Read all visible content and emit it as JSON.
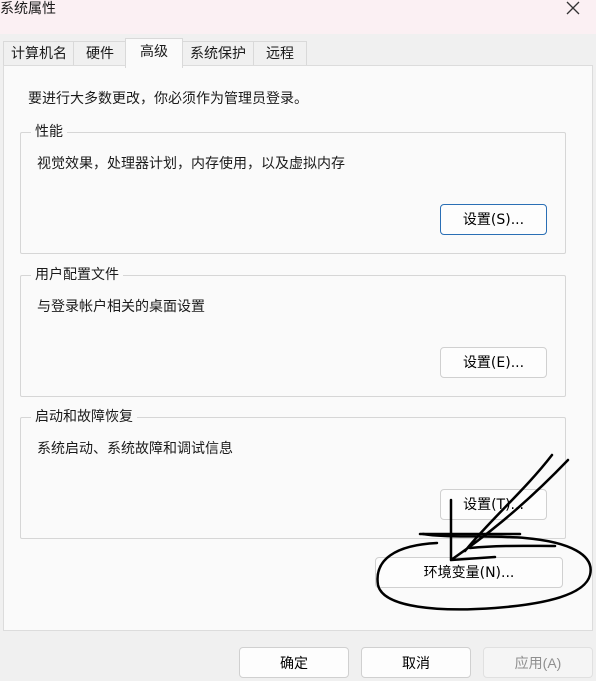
{
  "window": {
    "title": "系统属性"
  },
  "tabs": [
    {
      "label": "计算机名"
    },
    {
      "label": "硬件"
    },
    {
      "label": "高级"
    },
    {
      "label": "系统保护"
    },
    {
      "label": "远程"
    }
  ],
  "active_tab": "高级",
  "notice": "要进行大多数更改，你必须作为管理员登录。",
  "performance": {
    "title": "性能",
    "description": "视觉效果，处理器计划，内存使用，以及虚拟内存",
    "button": "设置(S)..."
  },
  "user_profiles": {
    "title": "用户配置文件",
    "description": "与登录帐户相关的桌面设置",
    "button": "设置(E)..."
  },
  "startup_recovery": {
    "title": "启动和故障恢复",
    "description": "系统启动、系统故障和调试信息",
    "button": "设置(T)..."
  },
  "env_button": "环境变量(N)...",
  "footer": {
    "ok": "确定",
    "cancel": "取消",
    "apply": "应用(A)"
  },
  "icons": {
    "close": "close-icon"
  },
  "colors": {
    "focus_border": "#2a6fb5",
    "annotation": "#000000"
  }
}
